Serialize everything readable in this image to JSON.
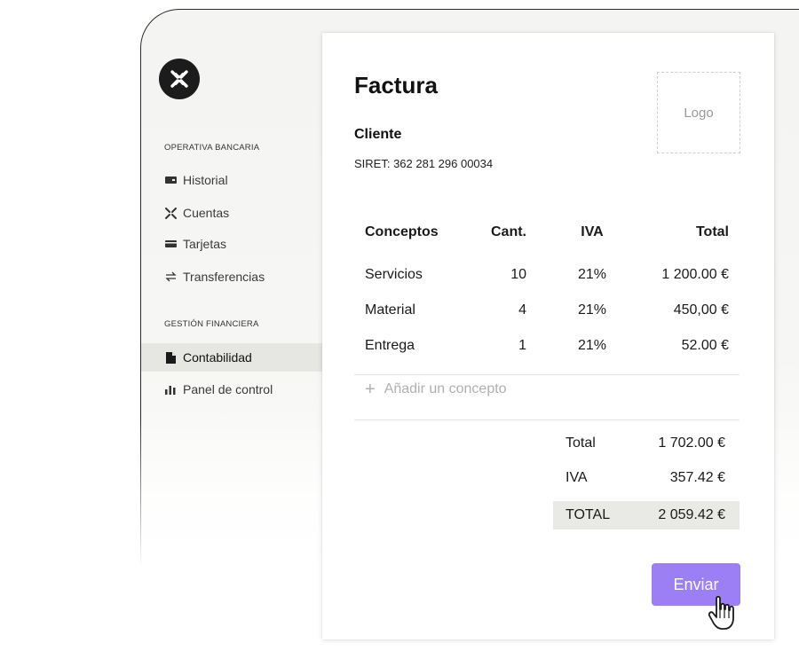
{
  "sidebar": {
    "sections": [
      {
        "label": "OPERATIVA BANCARIA",
        "items": [
          {
            "label": "Historial",
            "icon": "card-icon"
          },
          {
            "label": "Cuentas",
            "icon": "x-arrows-icon"
          },
          {
            "label": "Tarjetas",
            "icon": "wallet-icon"
          },
          {
            "label": "Transferencias",
            "icon": "transfer-icon"
          }
        ]
      },
      {
        "label": "GESTIÓN FINANCIERA",
        "items": [
          {
            "label": "Contabilidad",
            "icon": "document-icon",
            "active": true
          },
          {
            "label": "Panel de control",
            "icon": "bar-chart-icon"
          }
        ]
      }
    ]
  },
  "invoice": {
    "title": "Factura",
    "client_label": "Cliente",
    "siret": "SIRET: 362 281 296 00034",
    "logo_placeholder": "Logo",
    "columns": [
      "Conceptos",
      "Cant.",
      "IVA",
      "Total"
    ],
    "rows": [
      {
        "concept": "Servicios",
        "qty": "10",
        "iva": "21%",
        "total": "1 200.00 €"
      },
      {
        "concept": "Material",
        "qty": "4",
        "iva": "21%",
        "total": "450,00 €"
      },
      {
        "concept": "Entrega",
        "qty": "1",
        "iva": "21%",
        "total": "52.00 €"
      }
    ],
    "add_concept": "Añadir un concepto",
    "summary": [
      {
        "label": "Total",
        "value": "1 702.00 €"
      },
      {
        "label": "IVA",
        "value": "357.42 €"
      },
      {
        "label": "TOTAL",
        "value": "2 059.42 €"
      }
    ],
    "send_label": "Enviar"
  },
  "colors": {
    "accent": "#9c7ef5",
    "brand_dark": "#1c1c1c",
    "active_nav_bg": "#e6e6e3",
    "grand_total_bg": "#e9e9e6"
  }
}
